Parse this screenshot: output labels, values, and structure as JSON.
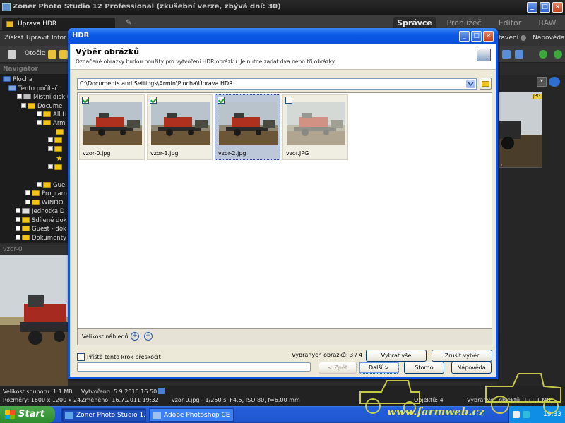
{
  "app": {
    "title": "Zoner Photo Studio 12 Professional (zkušební verze, zbývá dní: 30)",
    "doc_tab": "Úprava HDR",
    "mode_tabs": [
      "Správce",
      "Prohlížeč",
      "Editor",
      "RAW"
    ],
    "active_mode": "Správce",
    "menu": [
      "Získat",
      "Upravit",
      "Infor"
    ],
    "menu_right": [
      "tavení",
      "Nápověda"
    ],
    "toolbar_label": "Otočit:"
  },
  "navigator": {
    "header": "Navigátor",
    "tree": [
      "Plocha",
      "Tento počítač",
      "Místní disk (",
      "Docume",
      "All U",
      "Arm",
      "Gue",
      "Program",
      "WINDO",
      "Jednotka D",
      "Sdílené dok",
      "Guest - dok",
      "Dokumenty"
    ]
  },
  "preview": {
    "header": "vzor-0"
  },
  "right_panel": {
    "thumb_badge": "JPG",
    "thumb_caption": "r"
  },
  "status": {
    "file_size": "Velikost souboru: 1.1 MB",
    "created": "Vytvořeno: 5.9.2010 16:50",
    "dimensions": "Rozměry: 1600 x 1200 x 24",
    "modified": "Změněno: 16.7.2011 19:32",
    "exif": "vzor-0.jpg - 1/250 s, F4.5, ISO 80, f=6.00 mm",
    "objects": "Objektů: 4",
    "selected": "Vybraných objektů: 1 (1.1 MB)"
  },
  "taskbar": {
    "start": "Start",
    "tasks": [
      "Zoner Photo Studio 1...",
      "Adobe Photoshop CE"
    ],
    "clock": "19:33"
  },
  "dialog": {
    "title": "HDR",
    "heading": "Výběr obrázků",
    "description": "Označené obrázky budou použity pro vytvoření HDR obrázku. Je nutné zadat dva nebo tři obrázky.",
    "path": "C:\\Documents and Settings\\Armin\\Plocha\\Úprava HDR",
    "images": [
      {
        "name": "vzor-0.jpg",
        "checked": true,
        "selected": false
      },
      {
        "name": "vzor-1.jpg",
        "checked": true,
        "selected": false
      },
      {
        "name": "vzor-2.jpg",
        "checked": true,
        "selected": true
      },
      {
        "name": "vzor.JPG",
        "checked": false,
        "selected": false
      }
    ],
    "thumb_size_label": "Velikost náhledů:",
    "skip_label": "Příště tento krok přeskočit",
    "skip_checked": false,
    "selected_count": "Vybraných obrázků: 3 / 4",
    "select_all": "Vybrat vše",
    "deselect": "Zrušit výběr",
    "progress": 0,
    "back": "< Zpět",
    "next": "Další >",
    "cancel": "Storno",
    "help": "Nápověda"
  },
  "watermark": "www.farmweb.cz",
  "colors": {
    "xp_blue": "#0b55e0",
    "dialog_face": "#ece9d8",
    "folder": "#f0c419",
    "check": "#21a121"
  }
}
